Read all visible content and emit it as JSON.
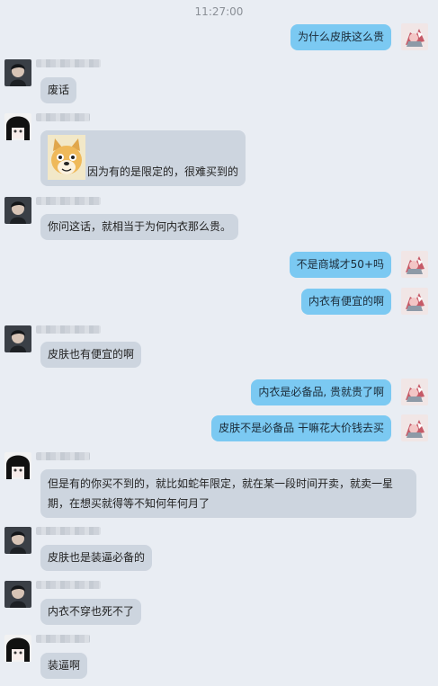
{
  "timestamp": "11:27:00",
  "messages": [
    {
      "id": "m1",
      "side": "right",
      "text": "为什么皮肤这么贵"
    },
    {
      "id": "m2",
      "side": "left",
      "avatar": "photo",
      "text": "废话"
    },
    {
      "id": "m3",
      "side": "left",
      "avatar": "anime",
      "text": "因为有的是限定的，很难买到的",
      "sticker": "doge-sticker"
    },
    {
      "id": "m4",
      "side": "left",
      "avatar": "photo",
      "text": "你问这话，就相当于为何内衣那么贵。"
    },
    {
      "id": "m5",
      "side": "right",
      "text": "不是商城才50+吗"
    },
    {
      "id": "m6",
      "side": "right",
      "text": "内衣有便宜的啊"
    },
    {
      "id": "m7",
      "side": "left",
      "avatar": "photo",
      "text": "皮肤也有便宜的啊"
    },
    {
      "id": "m8",
      "side": "right",
      "text": "内衣是必备品, 贵就贵了啊"
    },
    {
      "id": "m9",
      "side": "right",
      "text": "皮肤不是必备品 干嘛花大价钱去买"
    },
    {
      "id": "m10",
      "side": "left",
      "avatar": "anime",
      "text": "但是有的你买不到的，就比如蛇年限定，就在某一段时间开卖，就卖一星期，在想买就得等不知何年何月了"
    },
    {
      "id": "m11",
      "side": "left",
      "avatar": "photo",
      "text": "皮肤也是装逼必备的"
    },
    {
      "id": "m12",
      "side": "left",
      "avatar": "photo",
      "text": "内衣不穿也死不了"
    },
    {
      "id": "m13",
      "side": "left",
      "avatar": "anime",
      "text": "装逼啊"
    }
  ],
  "colors": {
    "background": "#e9edf3",
    "incoming_bubble": "#cdd5df",
    "outgoing_bubble": "#7bc9f2",
    "timestamp_text": "#8a8f96"
  }
}
